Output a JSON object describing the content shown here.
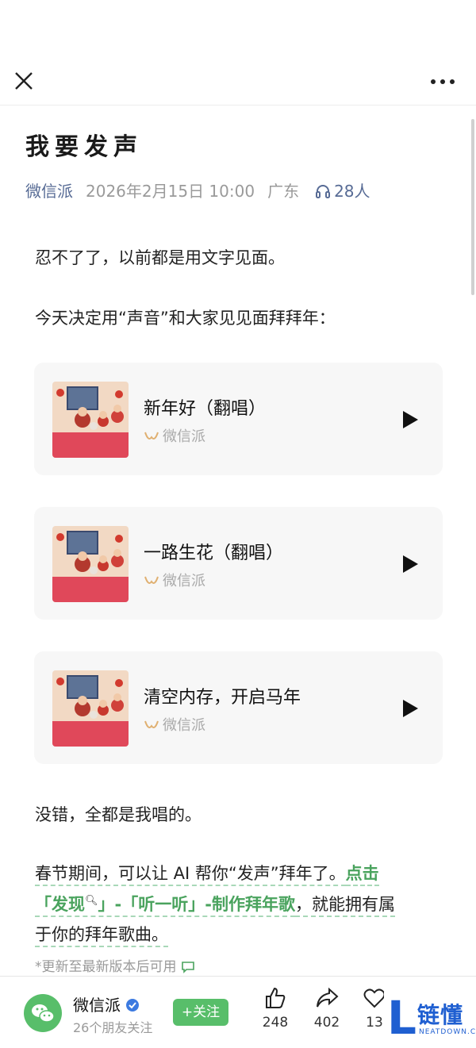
{
  "header": {
    "close_icon": "close-icon",
    "more_icon": "more-dots-icon"
  },
  "article": {
    "title": "我要发声",
    "author": "微信派",
    "date": "2026年2月15日 10:00",
    "region": "广东",
    "listeners": "28人",
    "p1": "忍不了了，以前都是用文字见面。",
    "p2": "今天决定用“声音”和大家见见面拜拜年：",
    "p3": "没错，全都是我唱的。",
    "p4_line1_plain": "春节期间，可以让 AI 帮你“发声”拜年了。",
    "p4_line1_link": "点击",
    "p4_line2_link": "「发现",
    "p4_line2_link_b": "」-「听一听」-制作拜年歌",
    "p4_line2_plain": "，就能拥有属",
    "p4_line3": "于你的拜年歌曲。",
    "note": "*更新至最新版本后可用"
  },
  "songs": [
    {
      "title": "新年好（翻唱）",
      "source": "微信派"
    },
    {
      "title": "一路生花（翻唱）",
      "source": "微信派"
    },
    {
      "title": "清空内存，开启马年",
      "source": "微信派"
    }
  ],
  "footer": {
    "account_name": "微信派",
    "friends_following": "26个朋友关注",
    "follow_label": "+关注",
    "likes": "248",
    "shares": "402",
    "favorites": "13"
  },
  "watermark": {
    "brand": "链懂",
    "sub": "NEATDOWN.COM"
  },
  "colors": {
    "accent_green": "#58be6a",
    "link_green": "#4aa35e",
    "meta_blue": "#576b95"
  }
}
